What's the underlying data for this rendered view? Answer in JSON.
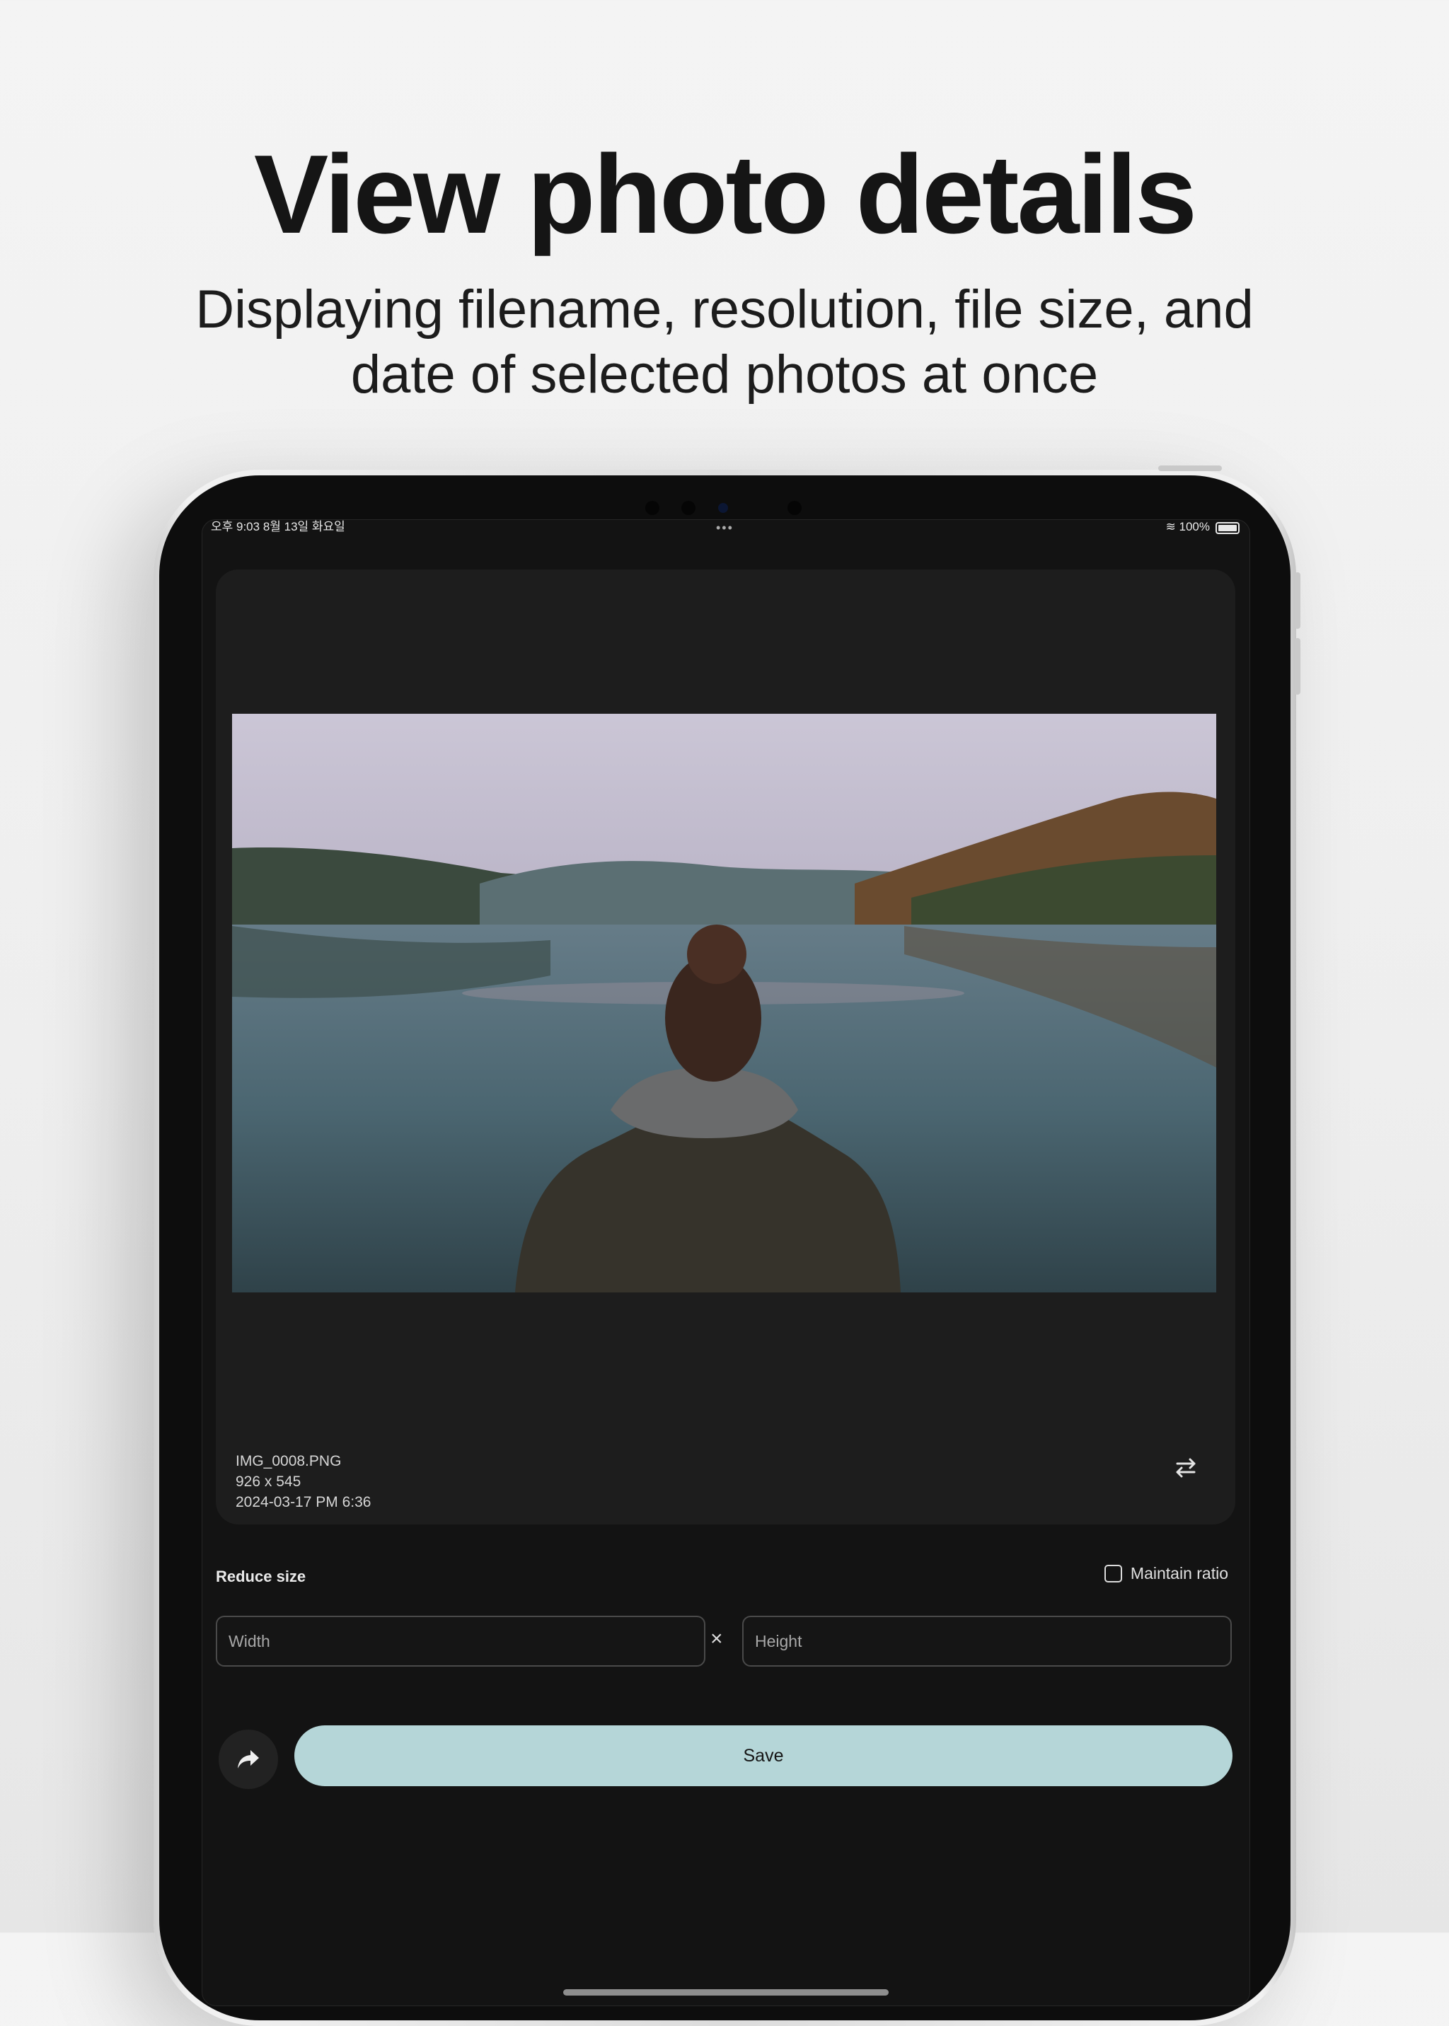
{
  "header": {
    "title": "View photo details",
    "subtitle_line1": "Displaying filename, resolution, file size, and",
    "subtitle_line2": "date of selected photos at once"
  },
  "status_bar": {
    "left": "오후 9:03   8월 13일 화요일",
    "right": "100%"
  },
  "photo": {
    "filename": "IMG_0008.PNG",
    "resolution": "926 x 545",
    "date": "2024-03-17 PM 6:36",
    "swap_icon": "swap-arrows-icon"
  },
  "reduce": {
    "label": "Reduce size",
    "maintain_ratio_label": "Maintain ratio",
    "maintain_ratio_checked": false,
    "width_placeholder": "Width",
    "height_placeholder": "Height",
    "separator": "×"
  },
  "actions": {
    "share_icon": "share-arrow-icon",
    "save_label": "Save"
  },
  "colors": {
    "screen_bg": "#131313",
    "card_bg": "#1d1d1d",
    "save_button": "#b5d6d8"
  }
}
